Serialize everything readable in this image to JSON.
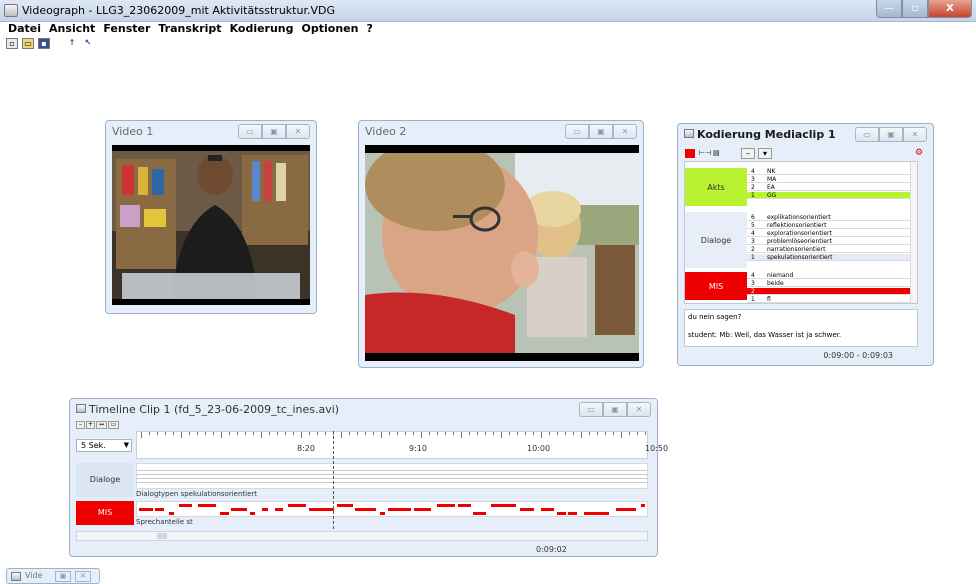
{
  "app": {
    "title": "Videograph - LLG3_23062009_mit Aktivitätsstruktur.VDG",
    "window_buttons": {
      "minimize": "—",
      "maximize": "▫",
      "close": "X"
    }
  },
  "menu": [
    "Datei",
    "Ansicht",
    "Fenster",
    "Transkript",
    "Kodierung",
    "Optionen",
    "?"
  ],
  "toolbar": [
    "new-file-icon",
    "open-folder-icon",
    "save-icon",
    "pin-icon",
    "help-pointer-icon"
  ],
  "video1": {
    "title": "Video 1"
  },
  "video2": {
    "title": "Video 2"
  },
  "kodierung": {
    "title": "Kodierung Mediaclip 1",
    "groups": [
      {
        "label": "Akts",
        "color": "#b8f233",
        "items": [
          {
            "n": "4",
            "t": "NK"
          },
          {
            "n": "3",
            "t": "MA"
          },
          {
            "n": "2",
            "t": "EA"
          },
          {
            "n": "1",
            "t": "GG"
          }
        ]
      },
      {
        "label": "Dialoge",
        "color": "#e8eef7",
        "items": [
          {
            "n": "6",
            "t": "explikationsorientiert"
          },
          {
            "n": "5",
            "t": "reflektionsorientiert"
          },
          {
            "n": "4",
            "t": "explorationsorientiert"
          },
          {
            "n": "3",
            "t": "problemlöseorientiert"
          },
          {
            "n": "2",
            "t": "narrationsorientiert"
          },
          {
            "n": "1",
            "t": "spekulationsorientiert"
          }
        ]
      },
      {
        "label": "MIS",
        "color": "#ee0000",
        "items": [
          {
            "n": "4",
            "t": "niemand"
          },
          {
            "n": "3",
            "t": "beide"
          },
          {
            "n": "2",
            "t": ""
          },
          {
            "n": "1",
            "t": "fl"
          }
        ]
      }
    ],
    "transcript": [
      "du nein sagen?",
      "student: Mb: Weil, das Wasser ist ja schwer."
    ],
    "timecode": "0:09:00 - 0:09:03",
    "accent_colors": {
      "green": "#b8f233",
      "red": "#ee0000"
    }
  },
  "timeline": {
    "title": "Timeline Clip 1 (fd_5_23-06-2009_tc_ines.avi)",
    "step_select": "5 Sek.",
    "ticks": [
      "8:20",
      "9:10",
      "10:00",
      "10:50"
    ],
    "tracks": [
      {
        "label": "Dialoge",
        "caption": "Dialogtypen spekulationsorientiert",
        "color": "#dce6f3"
      },
      {
        "label": "MIS",
        "caption": "Sprechanteile st",
        "color": "#ee0000"
      }
    ],
    "timecode": "0:09:02"
  },
  "taskbar": {
    "minimized_window": "Videograph"
  }
}
